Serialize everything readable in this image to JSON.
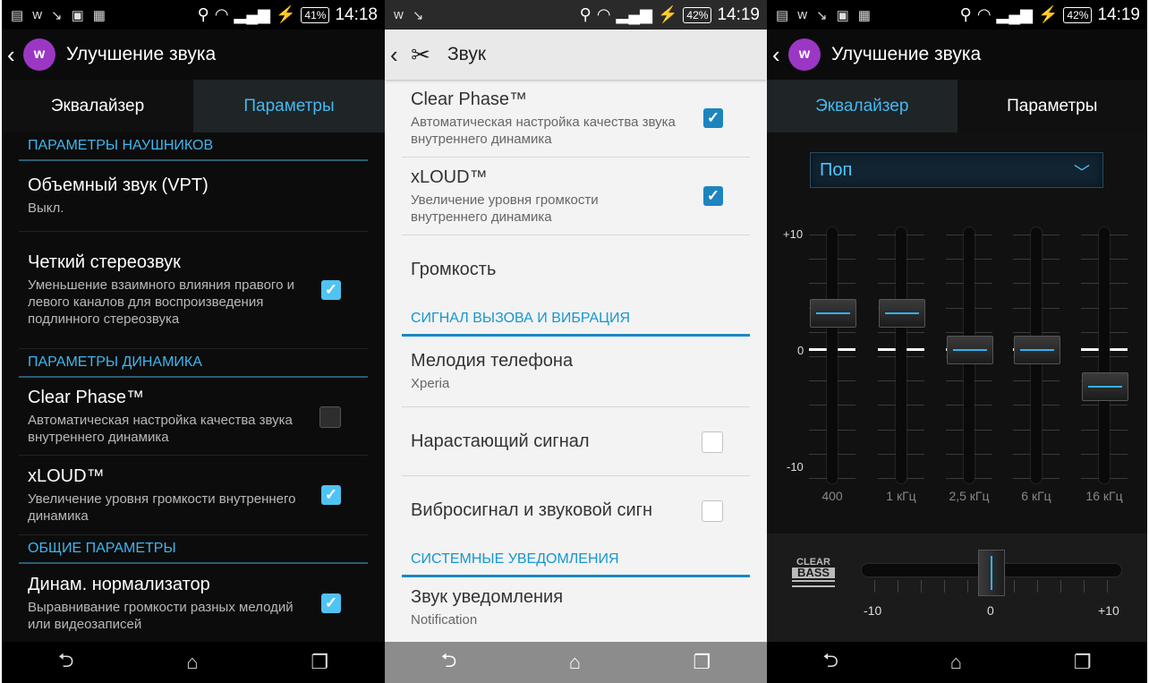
{
  "panel1": {
    "status": {
      "battery": "41%",
      "time": "14:18"
    },
    "title": "Улучшение звука",
    "tabs": [
      "Эквалайзер",
      "Параметры"
    ],
    "sections": {
      "headphones": "ПАРАМЕТРЫ НАУШНИКОВ",
      "speaker": "ПАРАМЕТРЫ ДИНАМИКА",
      "general": "ОБЩИЕ ПАРАМЕТРЫ"
    },
    "items": [
      {
        "title": "Объемный звук (VPT)",
        "sub": "Выкл."
      },
      {
        "title": "Четкий стереозвук",
        "sub": "Уменьшение взаимного влияния правого и левого каналов для воспроизведения подлинного стереозвука"
      },
      {
        "title": "Clear Phase™",
        "sub": "Автоматическая настройка качества звука внутреннего динамика"
      },
      {
        "title": "xLOUD™",
        "sub": "Увеличение уровня громкости внутреннего динамика"
      },
      {
        "title": "Динам. нормализатор",
        "sub": "Выравнивание громкости разных мелодий или видеозаписей"
      }
    ]
  },
  "panel2": {
    "status": {
      "battery": "42%",
      "time": "14:19"
    },
    "title": "Звук",
    "items": [
      {
        "title": "Clear Phase™",
        "sub": "Автоматическая настройка качества звука внутреннего динамика"
      },
      {
        "title": "xLOUD™",
        "sub": "Увеличение уровня громкости внутреннего динамика"
      },
      {
        "title": "Громкость"
      }
    ],
    "section_ring": "СИГНАЛ ВЫЗОВА И ВИБРАЦИЯ",
    "ring_items": [
      {
        "title": "Мелодия телефона",
        "sub": "Xperia"
      },
      {
        "title": "Нарастающий сигнал"
      },
      {
        "title": "Вибросигнал и звуковой сигн"
      }
    ],
    "section_system": "СИСТЕМНЫЕ УВЕДОМЛЕНИЯ",
    "system_items": [
      {
        "title": "Звук уведомления",
        "sub": "Notification"
      }
    ]
  },
  "panel3": {
    "status": {
      "battery": "42%",
      "time": "14:19"
    },
    "title": "Улучшение звука",
    "tabs": [
      "Эквалайзер",
      "Параметры"
    ],
    "preset": "Поп",
    "scale": {
      "top": "+10",
      "mid": "0",
      "bottom": "-10"
    },
    "bands": [
      {
        "label": "400",
        "level": 3
      },
      {
        "label": "1 кГц",
        "level": 3
      },
      {
        "label": "2,5 кГц",
        "level": 0
      },
      {
        "label": "6 кГц",
        "level": 0
      },
      {
        "label": "16 кГц",
        "level": -3
      }
    ],
    "clear_bass": {
      "logo_top": "CLEAR",
      "logo_bottom": "BASS",
      "min": "-10",
      "mid": "0",
      "max": "+10",
      "value": 0
    }
  },
  "colors": {
    "accent": "#3fb6ee",
    "accent_light_theme": "#1597d0",
    "walkman": "#9b37c4"
  }
}
